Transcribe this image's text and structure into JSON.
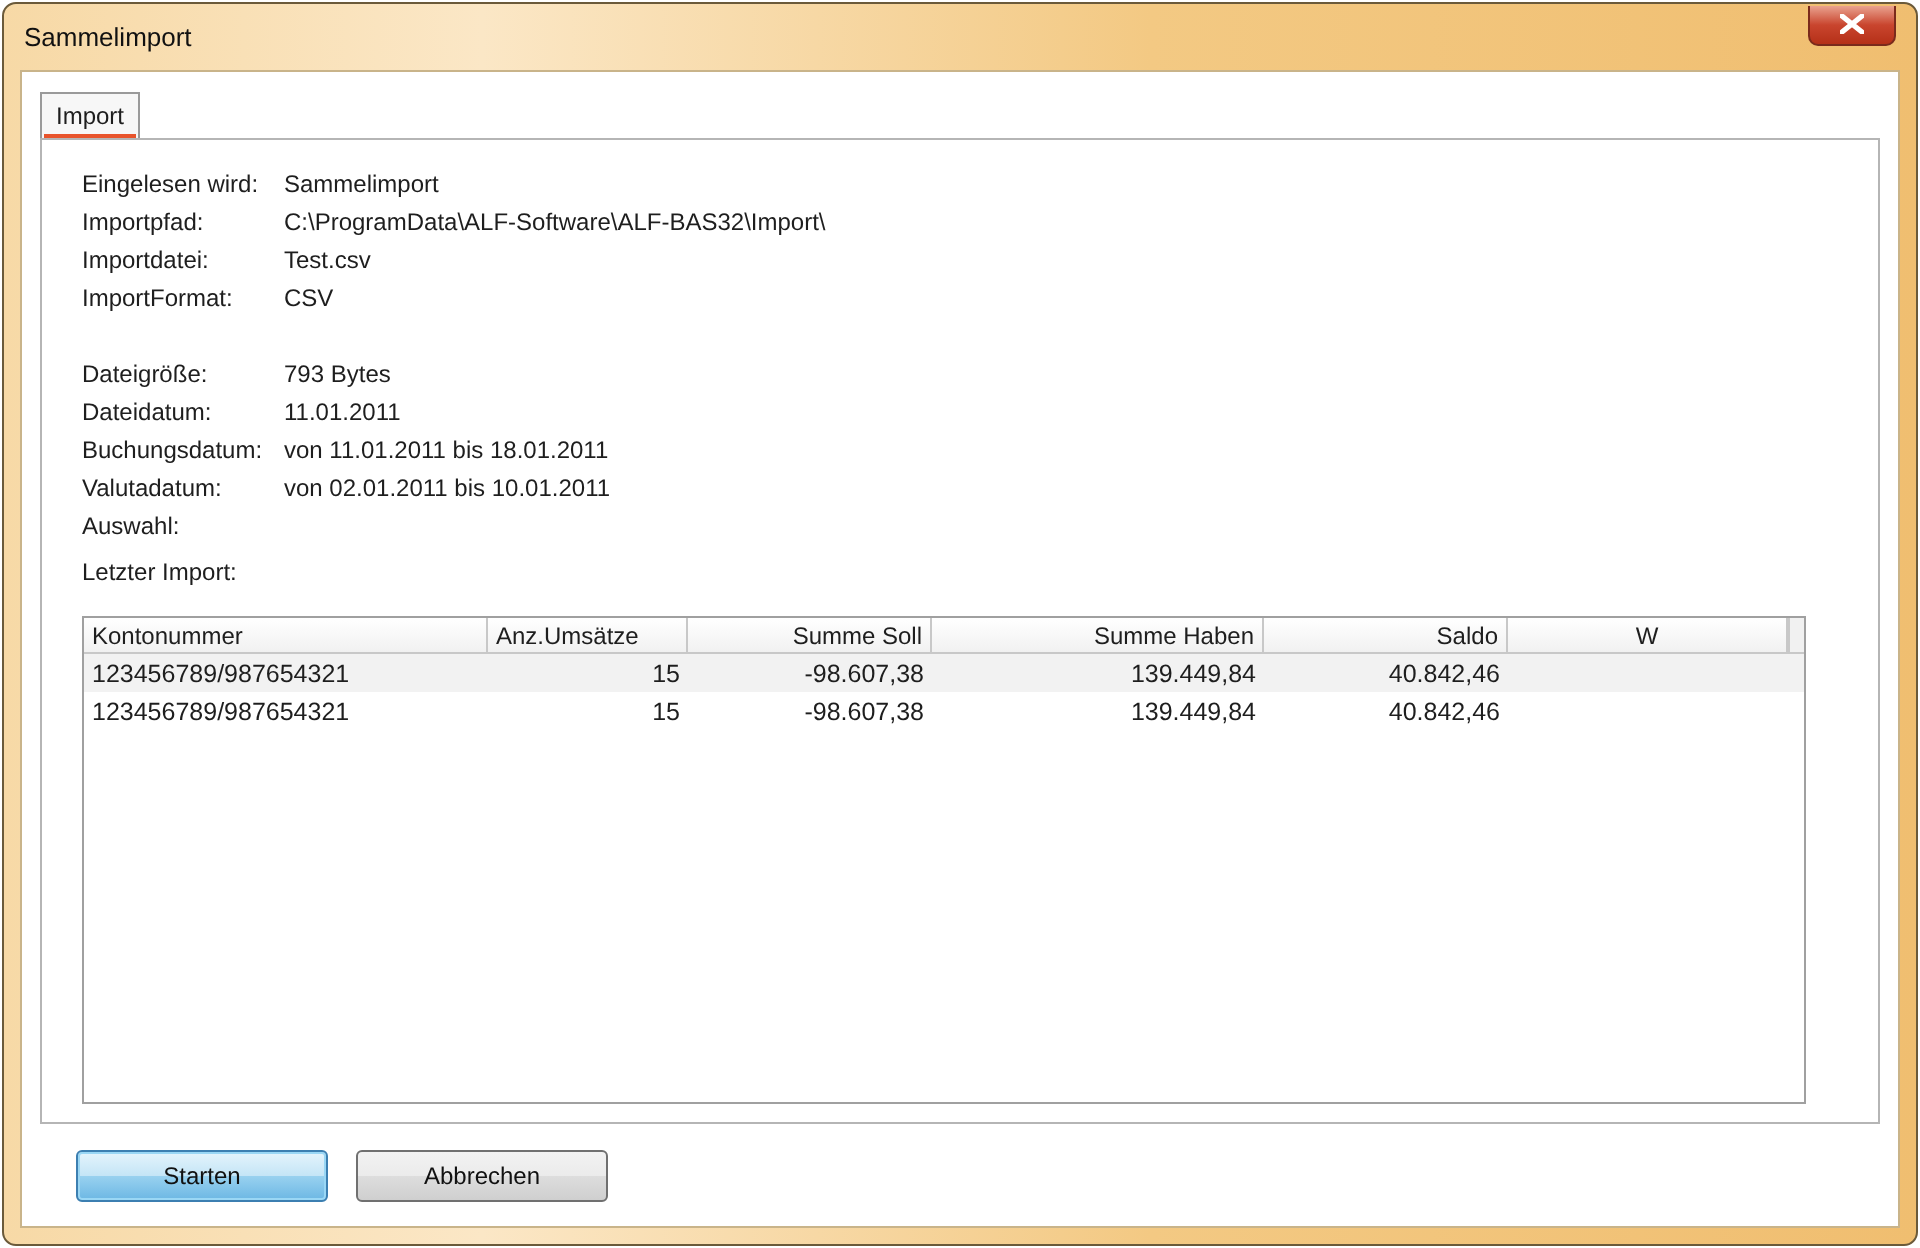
{
  "window": {
    "title": "Sammelimport"
  },
  "tabs": [
    {
      "label": "Import",
      "selected": true
    }
  ],
  "info_groups": [
    [
      {
        "label": "Eingelesen wird:",
        "value": "Sammelimport"
      },
      {
        "label": "Importpfad:",
        "value": "C:\\ProgramData\\ALF-Software\\ALF-BAS32\\Import\\"
      },
      {
        "label": "Importdatei:",
        "value": "Test.csv"
      },
      {
        "label": "ImportFormat:",
        "value": "CSV"
      }
    ],
    [
      {
        "label": "Dateigröße:",
        "value": "793 Bytes"
      },
      {
        "label": "Dateidatum:",
        "value": "11.01.2011"
      },
      {
        "label": "Buchungsdatum:",
        "value": "von 11.01.2011 bis 18.01.2011"
      },
      {
        "label": "Valutadatum:",
        "value": "von 02.01.2011 bis 10.01.2011"
      },
      {
        "label": "Auswahl:"
      }
    ]
  ],
  "last_import_label": "Letzter Import:",
  "table": {
    "columns": [
      {
        "label": "Kontonummer"
      },
      {
        "label": "Anz.Umsätze"
      },
      {
        "label": "Summe Soll"
      },
      {
        "label": "Summe Haben"
      },
      {
        "label": "Saldo"
      },
      {
        "label": "W"
      }
    ],
    "rows": [
      {
        "cells": [
          "123456789/987654321",
          "15",
          "-98.607,38",
          "139.449,84",
          "40.842,46",
          ""
        ],
        "selected": false
      },
      {
        "cells": [
          "123456789/987654321",
          "15",
          "-98.607,38",
          "139.449,84",
          "40.842,46",
          ""
        ],
        "selected": false
      }
    ]
  },
  "buttons": [
    {
      "label": "Starten",
      "default": true
    },
    {
      "label": "Abbrechen",
      "default": false
    }
  ]
}
